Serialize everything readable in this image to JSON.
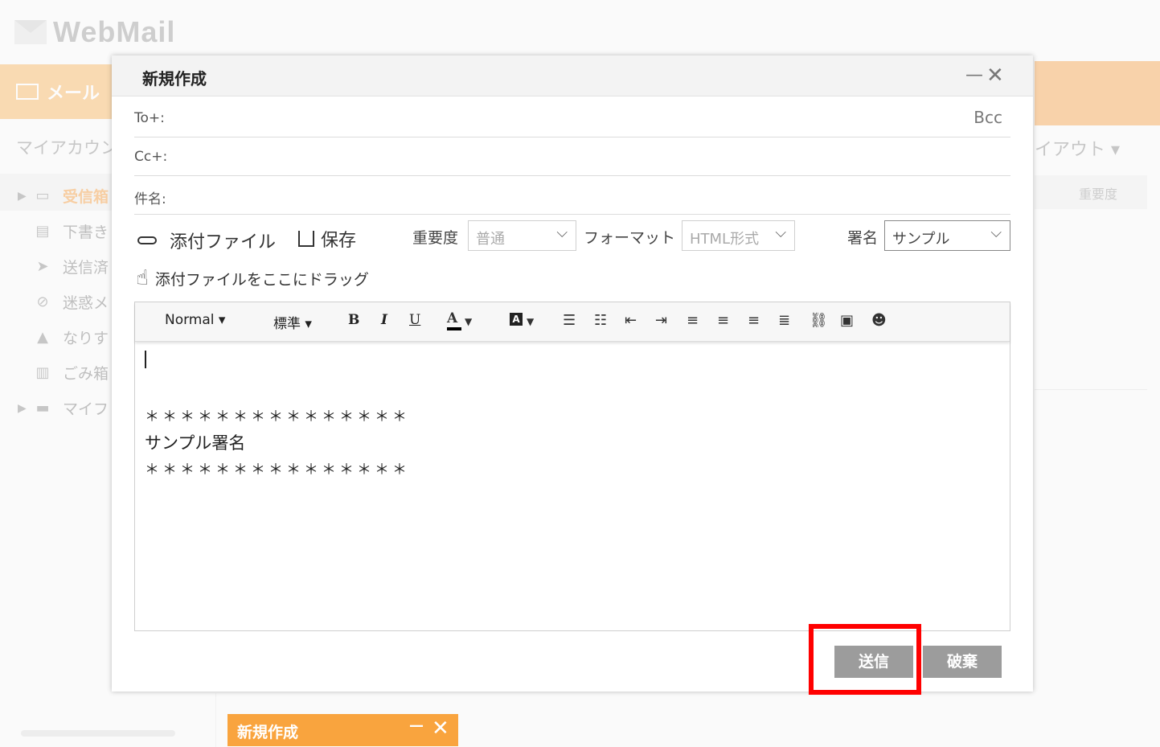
{
  "app": {
    "logo_text": "WebMail",
    "mail_tab": "メール"
  },
  "sidebar": {
    "my_account": "マイアカウン",
    "items": [
      {
        "label": "受信箱",
        "icon": "inbox-icon"
      },
      {
        "label": "下書き",
        "icon": "draft-icon"
      },
      {
        "label": "送信済",
        "icon": "send-icon"
      },
      {
        "label": "迷惑メ",
        "icon": "spam-icon"
      },
      {
        "label": "なりす",
        "icon": "warning-icon"
      },
      {
        "label": "ごみ箱",
        "icon": "trash-icon"
      },
      {
        "label": "マイフ",
        "icon": "folder-icon"
      }
    ]
  },
  "right_panel": {
    "layout_label": "イアウト ▾",
    "importance_header": "重要度"
  },
  "compose": {
    "title": "新規作成",
    "min_glyph": "—",
    "close_glyph": "✕",
    "to_label": "To+:",
    "bcc_label": "Bcc",
    "cc_label": "Cc+:",
    "subject_label": "件名:",
    "attach_label": "添付ファイル",
    "save_label": "保存",
    "importance_label": "重要度",
    "importance_value": "普通",
    "format_label": "フォーマット",
    "format_value": "HTML形式",
    "signature_label": "署名",
    "signature_value": "サンプル",
    "drag_hint": "添付ファイルをここにドラッグ",
    "toolbar": {
      "paragraph": "Normal ▾",
      "size": "標準 ▾",
      "bold": "B",
      "italic": "I",
      "underline": "U",
      "font_color": "A",
      "highlight": "A"
    },
    "body_lines": [
      "＊＊＊＊＊＊＊＊＊＊＊＊＊＊＊",
      "サンプル署名",
      "＊＊＊＊＊＊＊＊＊＊＊＊＊＊＊"
    ],
    "send_label": "送信",
    "discard_label": "破棄"
  },
  "minimized": {
    "title": "新規作成",
    "min_glyph": "—",
    "close_glyph": "✕"
  },
  "colors": {
    "accent": "#f9a43e",
    "highlight_box": "#ff0000",
    "button": "#9c9c9c"
  }
}
